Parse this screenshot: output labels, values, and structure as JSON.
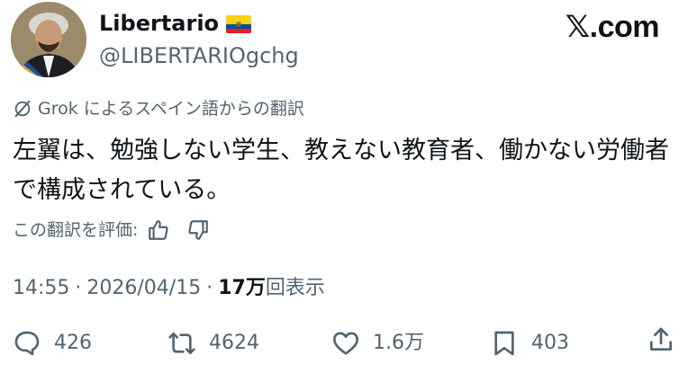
{
  "author": {
    "display_name": "Libertario",
    "handle": "@LIBERTARIOgchg",
    "flag_icon": "ecuador-flag-icon"
  },
  "site_logo": "𝕏.com",
  "translation": {
    "label": "Grok によるスペイン語からの翻訳",
    "icon": "grok-icon"
  },
  "tweet": {
    "text": "左翼は、勉強しない学生、教えない教育者、働かない労働者で構成されている。"
  },
  "rating": {
    "label": "この翻訳を評価:",
    "icons": [
      "thumbs-up-icon",
      "thumbs-down-icon"
    ]
  },
  "meta": {
    "time": "14:55",
    "date": "2026/04/15",
    "views_count": "17万",
    "views_label": "回表示"
  },
  "actions": {
    "replies": "426",
    "retweets": "4624",
    "likes": "1.6万",
    "bookmarks": "403"
  },
  "colors": {
    "text_primary": "#0f1419",
    "text_secondary": "#536471",
    "background": "#ffffff"
  }
}
